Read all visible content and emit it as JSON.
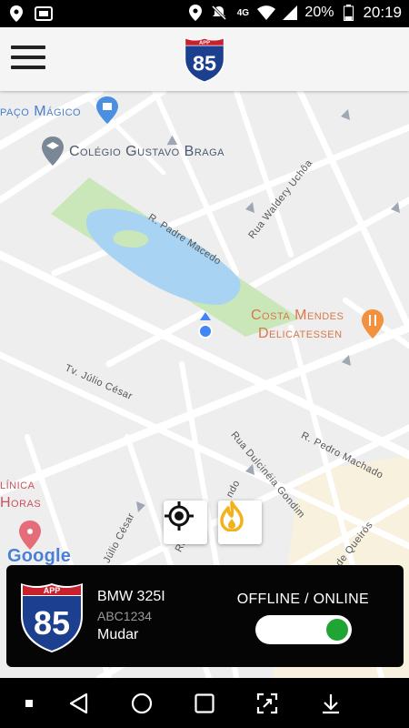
{
  "status_bar": {
    "battery": "20%",
    "time": "20:19",
    "network": "4G",
    "icons": [
      "location-icon",
      "screen-share-icon",
      "location-icon",
      "mute-icon",
      "signal-4g-icon",
      "wifi-icon",
      "signal-icon",
      "battery-icon"
    ]
  },
  "header": {
    "logo_top": "APP",
    "logo_number": "85"
  },
  "map": {
    "streets": [
      "R. Padre Macedo",
      "Rua Waldery Uchôa",
      "Tv. Júlio César",
      "Rua Dulcinéia Gondim",
      "R. Pedro Machado",
      "Júlio César",
      "Rua Ca",
      "ndo",
      "de Queirós"
    ],
    "places": {
      "paco": "paço Mágico",
      "colegio": "Colégio Gustavo Braga",
      "costa1": "Costa Mendes",
      "costa2": "Delicatessen",
      "clinica1": "línica",
      "clinica2": "Horas"
    },
    "google": "Google",
    "colors": {
      "park": "#c9e7b9",
      "lake": "#a9d3f2",
      "road": "#ffffff",
      "poi_text": "#d9774a",
      "school_text": "#4a5a6a"
    }
  },
  "map_buttons": {
    "locate_icon": "crosshair-icon",
    "fire_icon": "flame-icon"
  },
  "driver_card": {
    "logo_top": "APP",
    "logo_number": "85",
    "car_name": "BMW 325I",
    "car_plate": "ABC1234",
    "change_label": "Mudar",
    "status_label": "OFFLINE / ONLINE",
    "online": true
  },
  "nav_bar": {
    "icons": [
      "dot-icon",
      "back-icon",
      "home-icon",
      "recents-icon",
      "screenshot-icon",
      "download-icon"
    ]
  }
}
